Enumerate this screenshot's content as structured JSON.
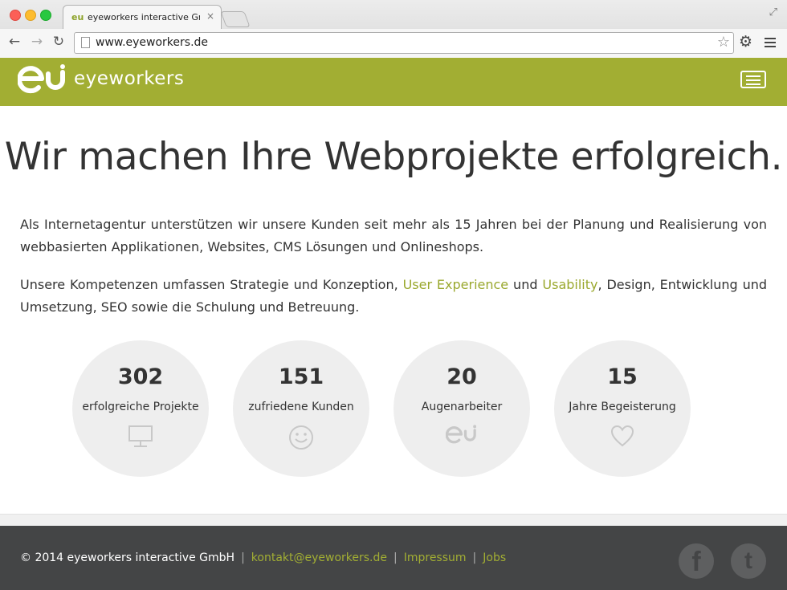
{
  "browser": {
    "tab_favicon": "eu",
    "tab_title": "eyeworkers interactive GmbH",
    "tab_close": "×",
    "url": "www.eyeworkers.de",
    "icons": {
      "back": "back-arrow-icon",
      "forward": "forward-arrow-icon",
      "reload": "reload-icon",
      "bookmark": "star-icon",
      "settings": "gear-icon",
      "menu": "menu-icon"
    }
  },
  "header": {
    "logo_text": "eyeworkers",
    "accent_color": "#a2ae33"
  },
  "main": {
    "headline": "Wir machen Ihre Webprojekte erfolgreich.",
    "p1": "Als Internetagentur unterstützen wir unsere Kunden seit mehr als 15 Jahren bei der Planung und Realisierung von webbasierten Applikationen, Websites, CMS Lösungen und Onlineshops.",
    "p2_before": "Unsere Kompetenzen umfassen Strategie und Konzeption, ",
    "p2_link1": "User Experience",
    "p2_mid": " und ",
    "p2_link2": "Usability",
    "p2_after": ", Design, Entwicklung und Umsetzung, SEO sowie die Schulung und Betreuung."
  },
  "stats": [
    {
      "number": "302",
      "label": "erfolgreiche Projekte",
      "icon": "monitor-icon"
    },
    {
      "number": "151",
      "label": "zufriedene Kunden",
      "icon": "smiley-icon"
    },
    {
      "number": "20",
      "label": "Augenarbeiter",
      "icon": "eu-logo-icon"
    },
    {
      "number": "15",
      "label": "Jahre Begeisterung",
      "icon": "heart-icon"
    }
  ],
  "footer": {
    "copyright": "© 2014 eyeworkers interactive GmbH",
    "sep": "|",
    "email": "kontakt@eyeworkers.de",
    "impressum": "Impressum",
    "jobs": "Jobs",
    "facebook_glyph": "f",
    "twitter_glyph": "t"
  }
}
